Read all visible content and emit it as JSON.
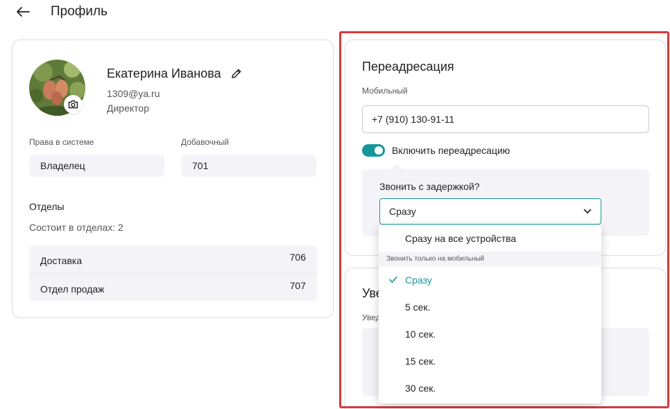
{
  "header": {
    "back_icon": "arrow-left-icon",
    "title": "Профиль"
  },
  "profile": {
    "name": "Екатерина Иванова",
    "email": "1309@ya.ru",
    "role": "Директор",
    "rights_label": "Права в системе",
    "rights_value": "Владелец",
    "extension_label": "Добавочный",
    "extension_value": "701",
    "departments_title": "Отделы",
    "departments_summary": "Состоит в отделах: 2",
    "departments": [
      {
        "name": "Доставка",
        "number": "706"
      },
      {
        "name": "Отдел продаж",
        "number": "707"
      }
    ]
  },
  "forwarding": {
    "title": "Переадресация",
    "mobile_label": "Мобильный",
    "mobile_value": "+7 (910) 130-91-11",
    "toggle_label": "Включить переадресацию",
    "toggle_on": true,
    "delay_title": "Звонить с задержкой?",
    "delay_selected": "Сразу"
  },
  "notify": {
    "title_visible": "Уве",
    "label_visible": "Увед"
  },
  "dropdown": {
    "first_option": "Сразу на все устройства",
    "group_label": "Звонить только на мобильный",
    "options": [
      "Сразу",
      "5 сек.",
      "10 сек.",
      "15 сек.",
      "30 сек."
    ],
    "selected_index": 0
  },
  "colors": {
    "accent": "#13979b",
    "highlight": "#d63a3a",
    "field_bg": "#f4f4f8"
  }
}
